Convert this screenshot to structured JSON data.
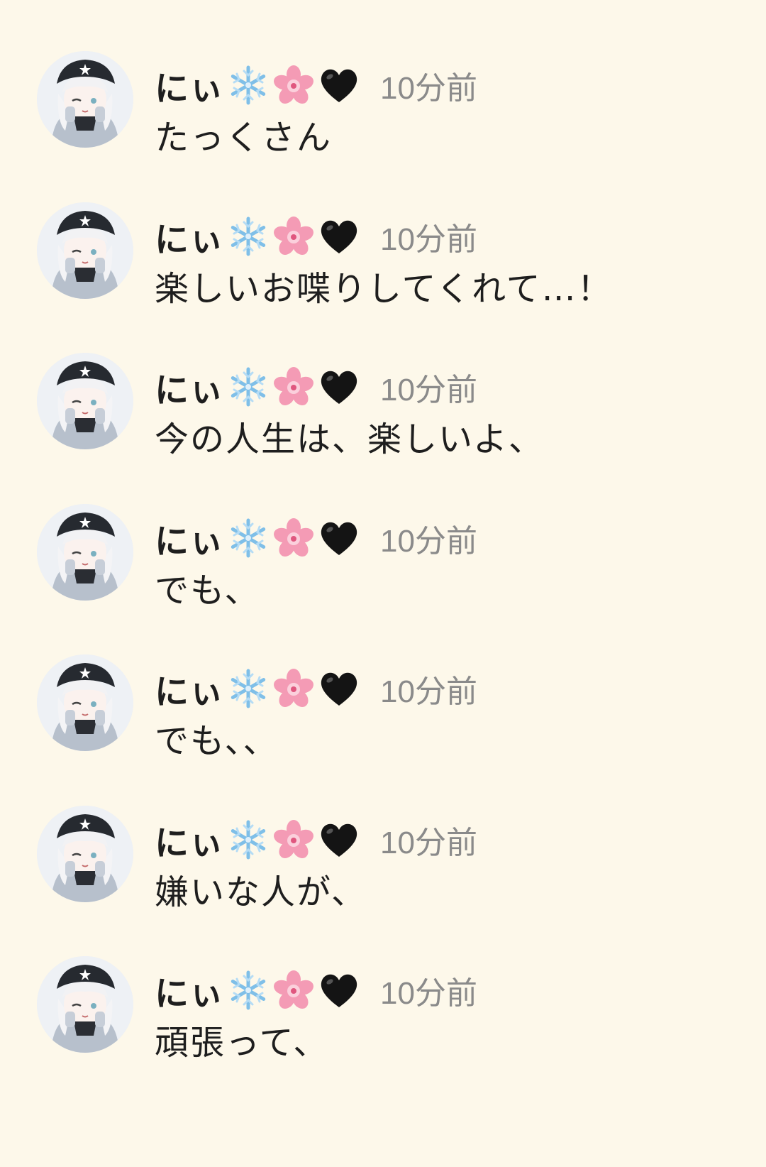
{
  "user_name": "にぃ",
  "name_emojis": [
    "snowflake-icon",
    "cherry-blossom-icon",
    "black-heart-icon"
  ],
  "colors": {
    "background": "#fdf8ea",
    "time_text": "#8a8a8a"
  },
  "messages": [
    {
      "time": "10分前",
      "text": "たっくさん"
    },
    {
      "time": "10分前",
      "text": "楽しいお喋りしてくれて…！"
    },
    {
      "time": "10分前",
      "text": "今の人生は、楽しいよ、"
    },
    {
      "time": "10分前",
      "text": "でも、"
    },
    {
      "time": "10分前",
      "text": "でも、、"
    },
    {
      "time": "10分前",
      "text": "嫌いな人が、"
    },
    {
      "time": "10分前",
      "text": "頑張って、"
    }
  ]
}
